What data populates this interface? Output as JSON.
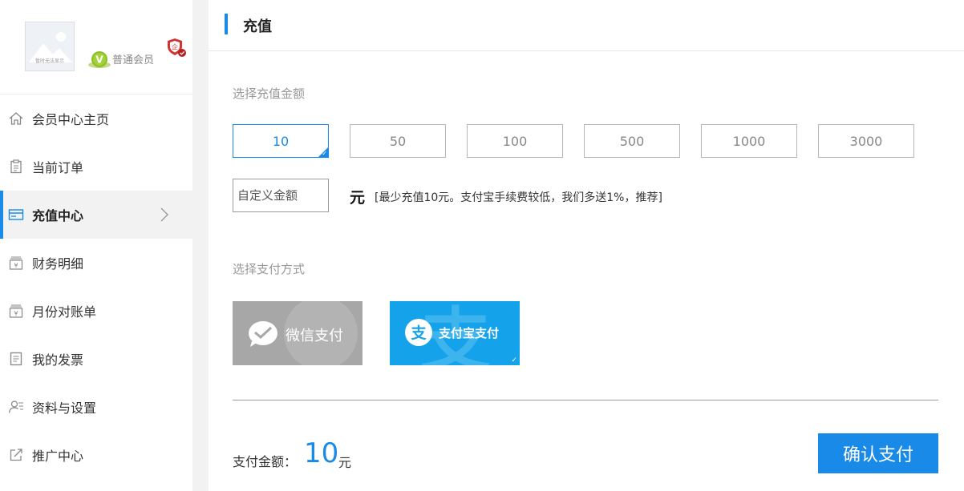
{
  "colors": {
    "accent": "#1a8ae8",
    "wechat": "#a7a7a7",
    "alipay": "#14a2ea"
  },
  "profile": {
    "avatar_caption": "暂时无法显示",
    "member_level": "普通会员",
    "badge_icon": "vip-v-icon",
    "security_icon": "enterprise-shield-icon"
  },
  "sidebar": {
    "items": [
      {
        "label": "会员中心主页",
        "icon": "home-icon"
      },
      {
        "label": "当前订单",
        "icon": "clipboard-icon"
      },
      {
        "label": "充值中心",
        "icon": "card-icon"
      },
      {
        "label": "财务明细",
        "icon": "yuan-tray-icon"
      },
      {
        "label": "月份对账单",
        "icon": "yuan-tray-icon"
      },
      {
        "label": "我的发票",
        "icon": "invoice-icon"
      },
      {
        "label": "资料与设置",
        "icon": "user-settings-icon"
      },
      {
        "label": "推广中心",
        "icon": "share-icon"
      }
    ],
    "active_index": 2
  },
  "header": {
    "title": "充值"
  },
  "recharge": {
    "amount_label": "选择充值金额",
    "amounts": [
      "10",
      "50",
      "100",
      "500",
      "1000",
      "3000"
    ],
    "selected_amount_index": 0,
    "custom_placeholder": "自定义金额",
    "unit": "元",
    "hint": "[最少充值10元。支付宝手续费较低，我们多送1%，推荐]"
  },
  "payment": {
    "label": "选择支付方式",
    "methods": [
      {
        "label": "微信支付",
        "icon": "wechat-icon"
      },
      {
        "label": "支付宝支付",
        "icon": "alipay-icon"
      }
    ],
    "selected_index": 1
  },
  "summary": {
    "label": "支付金额：",
    "amount": "10",
    "unit": "元",
    "confirm_label": "确认支付"
  }
}
